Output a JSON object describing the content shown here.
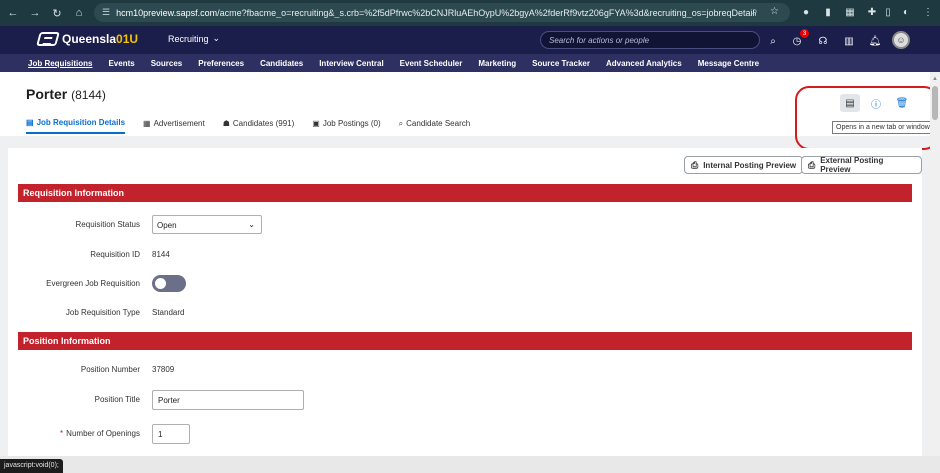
{
  "browser": {
    "url_host": "hcm10preview.sapsf.com",
    "url_rest": "/acme?fbacme_o=recruiting&_s.crb=%2f5dPfrwc%2bCNJRluAEhOypU%2bgyA%2fderRf9vtz206gFYA%3d&recruiting_os=jobreqDetail&recr...",
    "profile_badge": "3"
  },
  "app": {
    "logo_prefix": "Queensla",
    "logo_highlight": "01U",
    "module": "Recruiting",
    "search_placeholder": "Search for actions or people",
    "notifications_badge": "3"
  },
  "modnav": [
    "Job Requisitions",
    "Events",
    "Sources",
    "Preferences",
    "Candidates",
    "Interview Central",
    "Event Scheduler",
    "Marketing",
    "Source Tracker",
    "Advanced Analytics",
    "Message Centre"
  ],
  "page": {
    "title": "Porter",
    "title_num": "(8144)",
    "tabs": [
      {
        "label": "Job Requisition Details",
        "icon": "▤"
      },
      {
        "label": "Advertisement",
        "icon": "▦"
      },
      {
        "label": "Candidates (991)",
        "icon": "☗"
      },
      {
        "label": "Job Postings (0)",
        "icon": "▣"
      },
      {
        "label": "Candidate Search",
        "icon": "⌕"
      }
    ],
    "tooltip": "Opens in a new tab or window"
  },
  "buttons": {
    "internal_preview": "Internal Posting Preview",
    "external_preview": "External Posting Preview"
  },
  "sections": {
    "requisition": "Requisition Information",
    "position": "Position Information"
  },
  "fields": {
    "req_status_label": "Requisition Status",
    "req_status_value": "Open",
    "req_id_label": "Requisition ID",
    "req_id_value": "8144",
    "evergreen_label": "Evergreen Job Requisition",
    "evergreen_on": false,
    "req_type_label": "Job Requisition Type",
    "req_type_value": "Standard",
    "pos_num_label": "Position Number",
    "pos_num_value": "37809",
    "pos_title_label": "Position Title",
    "pos_title_value": "Porter",
    "openings_label": "Number of Openings",
    "openings_value": "1",
    "required_mark": "*"
  },
  "status_bar": "javascript:void(0);",
  "colors": {
    "section_red": "#c1222b",
    "header_navy": "#1b1d4b",
    "accent_blue": "#0a6ed1"
  }
}
